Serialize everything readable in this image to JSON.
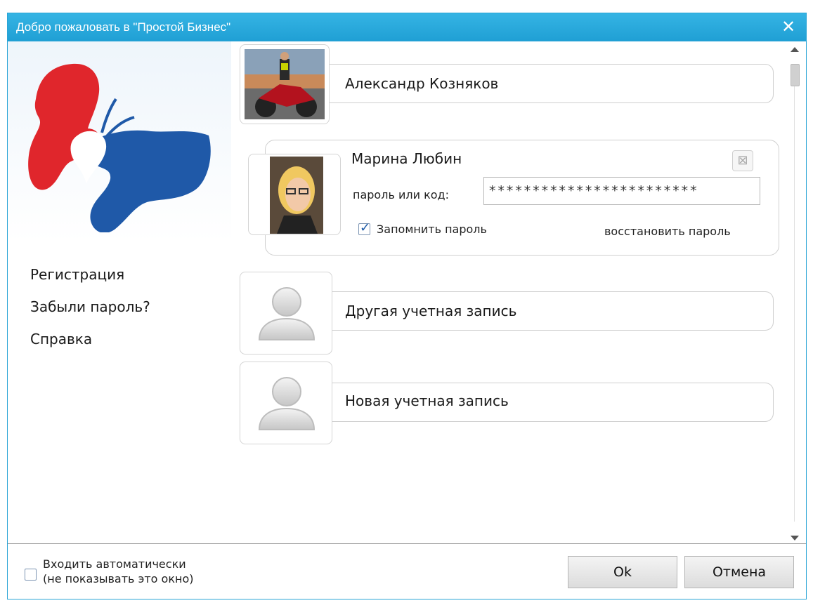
{
  "window": {
    "title": "Добро пожаловать в \"Простой Бизнес\"",
    "close_glyph": "✕"
  },
  "left_links": [
    "Регистрация",
    "Забыли пароль?",
    "Справка"
  ],
  "accounts": {
    "first": {
      "name": "Александр Козняков",
      "avatar_icon": "user-photo-motorcycle"
    },
    "selected": {
      "name": "Марина Любин",
      "password_label": "пароль или код:",
      "password_value": "************************",
      "remember_label": "Запомнить пароль",
      "remember_checked": true,
      "recover_label": "восстановить пароль",
      "remove_glyph": "⊠",
      "avatar_icon": "user-photo-woman"
    },
    "other": {
      "label": "Другая учетная запись",
      "avatar_icon": "generic-user-icon"
    },
    "new": {
      "label": "Новая учетная запись",
      "avatar_icon": "generic-user-icon"
    }
  },
  "bottom": {
    "auto_login_line1": "Входить автоматически",
    "auto_login_line2": "(не показывать это окно)",
    "auto_login_checked": false,
    "ok_label": "Ok",
    "cancel_label": "Отмена"
  },
  "colors": {
    "titlebar": "#29a4d6",
    "logo_red": "#e0262c",
    "logo_blue": "#1f59a8",
    "check_accent": "#1e5ba8"
  }
}
